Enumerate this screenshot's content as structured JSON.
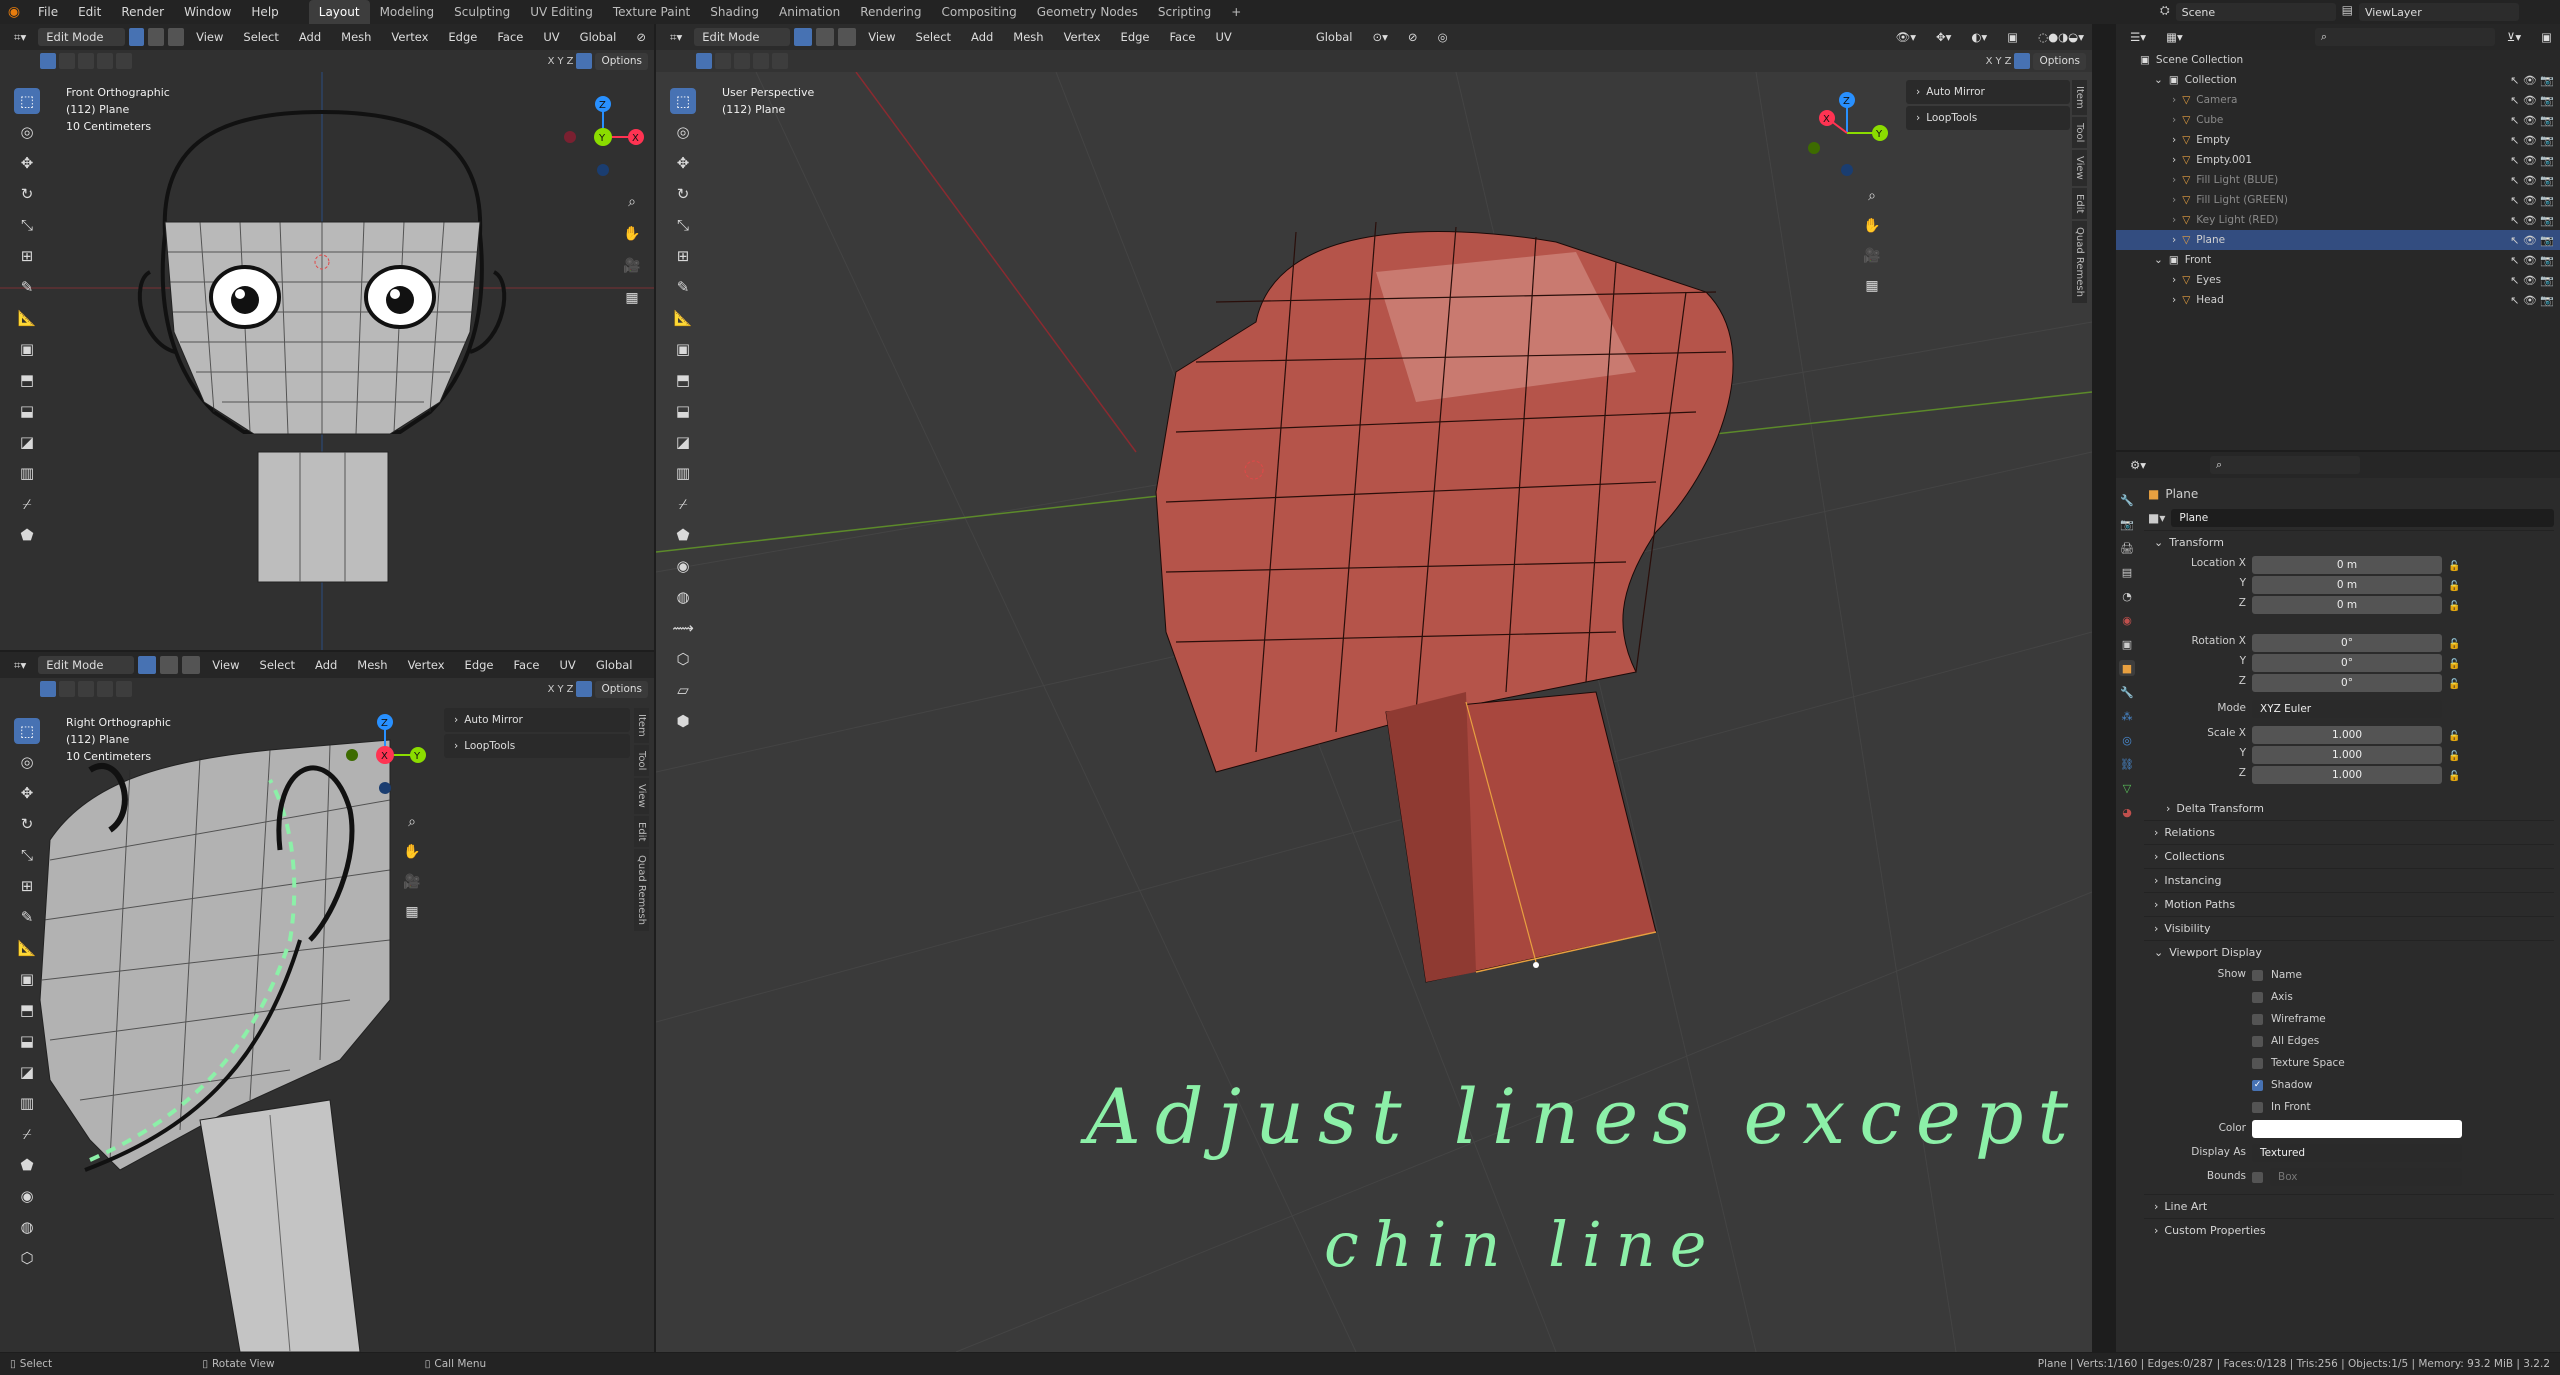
{
  "topbar": {
    "menus": [
      "File",
      "Edit",
      "Render",
      "Window",
      "Help"
    ],
    "workspaces": [
      "Layout",
      "Modeling",
      "Sculpting",
      "UV Editing",
      "Texture Paint",
      "Shading",
      "Animation",
      "Rendering",
      "Compositing",
      "Geometry Nodes",
      "Scripting"
    ],
    "active_workspace": "Layout",
    "add_tab": "+",
    "scene": "Scene",
    "view_layer": "ViewLayer"
  },
  "header": {
    "mode": "Edit Mode",
    "menus": [
      "View",
      "Select",
      "Add",
      "Mesh",
      "Vertex",
      "Edge",
      "Face",
      "UV"
    ],
    "transform_orientation": "Global",
    "options": "Options",
    "axes": [
      "X",
      "Y",
      "Z"
    ]
  },
  "viewport_front": {
    "title": "Front Orthographic",
    "object": "(112) Plane",
    "scale": "10 Centimeters"
  },
  "viewport_right": {
    "title": "Right Orthographic",
    "object": "(112) Plane",
    "scale": "10 Centimeters",
    "panels": [
      "Auto Mirror",
      "LoopTools"
    ]
  },
  "viewport_persp": {
    "title": "User Perspective",
    "object": "(112) Plane",
    "panels": [
      "Auto Mirror",
      "LoopTools"
    ],
    "annotation_line1": "Adjust lines except",
    "annotation_line2": "chin line"
  },
  "sidebar_tabs": [
    "Item",
    "Tool",
    "View",
    "Edit",
    "Quad Remesh"
  ],
  "outliner": {
    "root": "Scene Collection",
    "rows": [
      {
        "label": "Collection",
        "indent": 1,
        "state": "normal"
      },
      {
        "label": "Camera",
        "indent": 2,
        "state": "dim"
      },
      {
        "label": "Cube",
        "indent": 2,
        "state": "dim"
      },
      {
        "label": "Empty",
        "indent": 2,
        "state": "normal"
      },
      {
        "label": "Empty.001",
        "indent": 2,
        "state": "normal"
      },
      {
        "label": "Fill Light (BLUE)",
        "indent": 2,
        "state": "dim"
      },
      {
        "label": "Fill Light (GREEN)",
        "indent": 2,
        "state": "dim"
      },
      {
        "label": "Key Light (RED)",
        "indent": 2,
        "state": "dim"
      },
      {
        "label": "Plane",
        "indent": 2,
        "state": "selected"
      },
      {
        "label": "Front",
        "indent": 1,
        "state": "normal"
      },
      {
        "label": "Eyes",
        "indent": 2,
        "state": "normal"
      },
      {
        "label": "Head",
        "indent": 2,
        "state": "normal"
      }
    ]
  },
  "properties": {
    "object_name": "Plane",
    "datablock": "Plane",
    "transform_header": "Transform",
    "location": {
      "label_x": "Location X",
      "x": "0 m",
      "y": "0 m",
      "z": "0 m"
    },
    "rotation": {
      "label_x": "Rotation X",
      "x": "0°",
      "y": "0°",
      "z": "0°"
    },
    "mode_label": "Mode",
    "mode": "XYZ Euler",
    "scale": {
      "label_x": "Scale X",
      "x": "1.000",
      "y": "1.000",
      "z": "1.000"
    },
    "axis_y": "Y",
    "axis_z": "Z",
    "delta": "Delta Transform",
    "sections": [
      "Relations",
      "Collections",
      "Instancing",
      "Motion Paths",
      "Visibility"
    ],
    "viewport_display": "Viewport Display",
    "show_label": "Show",
    "checks": [
      {
        "label": "Name",
        "on": false
      },
      {
        "label": "Axis",
        "on": false
      },
      {
        "label": "Wireframe",
        "on": false
      },
      {
        "label": "All Edges",
        "on": false
      },
      {
        "label": "Texture Space",
        "on": false
      },
      {
        "label": "Shadow",
        "on": true
      },
      {
        "label": "In Front",
        "on": false
      }
    ],
    "color_label": "Color",
    "display_as_label": "Display As",
    "display_as": "Textured",
    "bounds_label": "Bounds",
    "bounds": "Box",
    "bottom_sections": [
      "Line Art",
      "Custom Properties"
    ]
  },
  "statusbar": {
    "select": "Select",
    "rotate": "Rotate View",
    "call_menu": "Call Menu",
    "stats": "Plane | Verts:1/160 | Edges:0/287 | Faces:0/128 | Tris:256 | Objects:1/5 | Memory: 93.2 MiB | 3.2.2"
  },
  "colors": {
    "accent": "#4772b3",
    "mesh_red": "#b5544a",
    "annotation_green": "#8cf0a8",
    "axis_red": "#ff3352",
    "axis_green": "#8bdc00",
    "axis_blue": "#2890ff"
  }
}
